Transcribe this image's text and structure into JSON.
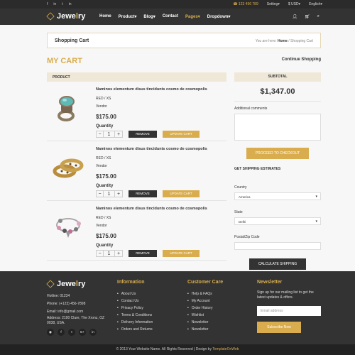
{
  "topbar": {
    "phone": "☎ 123 456 789",
    "settings": "Setting▾",
    "currency": "$ USD▾",
    "language": "English▾",
    "social": [
      "f",
      "in",
      "t",
      "in"
    ]
  },
  "nav": {
    "logo_pre": "Jewe",
    "logo_accent": "l",
    "logo_post": "ry",
    "items": [
      "Home",
      "Product▾",
      "Blog▾",
      "Contact",
      "Pages▾",
      "Dropdown▾"
    ],
    "active_index": 4
  },
  "breadcrumb": {
    "title": "Shopping Cart",
    "prefix": "You are here:",
    "home": "Home",
    "current": "/ Shopping Cart"
  },
  "cart": {
    "heading": "MY CART",
    "continue": "Continue Shopping",
    "product_header": "PRODUCT",
    "items": [
      {
        "name": "Naminos elementum disus tincidunts cosmo de cosmopolis",
        "option": "RED / XS",
        "vendor": "Vendor",
        "price": "$175.00",
        "qty_label": "Quantity",
        "qty": "1",
        "remove": "REMOVE",
        "update": "UPDATE CART"
      },
      {
        "name": "Naminos elementum disus tincidunts cosmo de cosmopolis",
        "option": "RED / XS",
        "vendor": "Vendor",
        "price": "$175.00",
        "qty_label": "Quantity",
        "qty": "1",
        "remove": "REMOVE",
        "update": "UPDATE CART"
      },
      {
        "name": "Naminos elementum disus tincidunts cosmo de cosmopolis",
        "option": "RED / XS",
        "vendor": "Vendor",
        "price": "$175.00",
        "qty_label": "Quantity",
        "qty": "1",
        "remove": "REMOVE",
        "update": "UPDATE CART"
      }
    ]
  },
  "summary": {
    "subtotal_header": "SUBTOTAL",
    "total": "$1,347.00",
    "comments_label": "Additional comments",
    "checkout": "PROCEED TO CHECKOUT",
    "ship_heading": "GET SHIPPING ESTIMATES",
    "country_label": "Country",
    "country_value": "America",
    "state_label": "State",
    "state_value": "Delhi",
    "zip_label": "Postal/Zip Code",
    "calc": "CALCULATE SHIPPING"
  },
  "footer": {
    "hotline": "Hotline: 01234",
    "phone": "Phone: (+123) 456-7898",
    "email": "Email: info@gmail.com",
    "address": "Address: 2190 Clure, The Xronz, OZ 0038, USA.",
    "social": [
      "f",
      "t",
      "G+",
      "in"
    ],
    "info_heading": "Information",
    "info_items": [
      "About Us",
      "Contact Us",
      "Privacy Policy",
      "Terms & Conditions",
      "Delivery Information",
      "Orders and Returns"
    ],
    "care_heading": "Customer Care",
    "care_items": [
      "Help & FAQs",
      "My Account",
      "Order History",
      "Wishlist",
      "Newsletter",
      "Newsletter"
    ],
    "news_heading": "Newsletter",
    "news_text": "Sign up for our mailing list to get the latest updates & offers.",
    "email_placeholder": "Email address",
    "subscribe": "Subscribe Now",
    "copyright": "© 2013 Your Website Name. All Rights Reserved | Design by",
    "designer": "TemplateOnWeb"
  }
}
